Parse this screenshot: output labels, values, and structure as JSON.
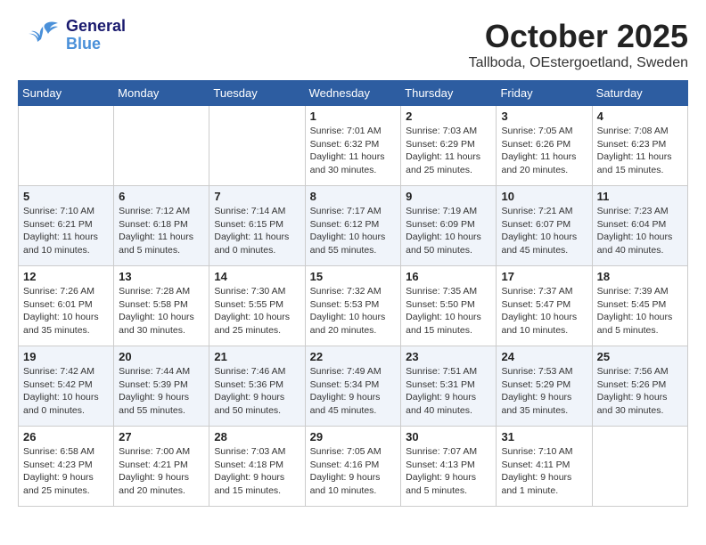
{
  "header": {
    "logo_general": "General",
    "logo_blue": "Blue",
    "month_title": "October 2025",
    "location": "Tallboda, OEstergoetland, Sweden"
  },
  "days_of_week": [
    "Sunday",
    "Monday",
    "Tuesday",
    "Wednesday",
    "Thursday",
    "Friday",
    "Saturday"
  ],
  "weeks": [
    {
      "id": "week1",
      "cells": [
        {
          "day": "",
          "number": "",
          "info": ""
        },
        {
          "day": "monday",
          "number": "",
          "info": ""
        },
        {
          "day": "tuesday",
          "number": "",
          "info": ""
        },
        {
          "day": "wednesday",
          "number": "1",
          "info": "Sunrise: 7:01 AM\nSunset: 6:32 PM\nDaylight: 11 hours\nand 30 minutes."
        },
        {
          "day": "thursday",
          "number": "2",
          "info": "Sunrise: 7:03 AM\nSunset: 6:29 PM\nDaylight: 11 hours\nand 25 minutes."
        },
        {
          "day": "friday",
          "number": "3",
          "info": "Sunrise: 7:05 AM\nSunset: 6:26 PM\nDaylight: 11 hours\nand 20 minutes."
        },
        {
          "day": "saturday",
          "number": "4",
          "info": "Sunrise: 7:08 AM\nSunset: 6:23 PM\nDaylight: 11 hours\nand 15 minutes."
        }
      ]
    },
    {
      "id": "week2",
      "cells": [
        {
          "day": "sunday",
          "number": "5",
          "info": "Sunrise: 7:10 AM\nSunset: 6:21 PM\nDaylight: 11 hours\nand 10 minutes."
        },
        {
          "day": "monday",
          "number": "6",
          "info": "Sunrise: 7:12 AM\nSunset: 6:18 PM\nDaylight: 11 hours\nand 5 minutes."
        },
        {
          "day": "tuesday",
          "number": "7",
          "info": "Sunrise: 7:14 AM\nSunset: 6:15 PM\nDaylight: 11 hours\nand 0 minutes."
        },
        {
          "day": "wednesday",
          "number": "8",
          "info": "Sunrise: 7:17 AM\nSunset: 6:12 PM\nDaylight: 10 hours\nand 55 minutes."
        },
        {
          "day": "thursday",
          "number": "9",
          "info": "Sunrise: 7:19 AM\nSunset: 6:09 PM\nDaylight: 10 hours\nand 50 minutes."
        },
        {
          "day": "friday",
          "number": "10",
          "info": "Sunrise: 7:21 AM\nSunset: 6:07 PM\nDaylight: 10 hours\nand 45 minutes."
        },
        {
          "day": "saturday",
          "number": "11",
          "info": "Sunrise: 7:23 AM\nSunset: 6:04 PM\nDaylight: 10 hours\nand 40 minutes."
        }
      ]
    },
    {
      "id": "week3",
      "cells": [
        {
          "day": "sunday",
          "number": "12",
          "info": "Sunrise: 7:26 AM\nSunset: 6:01 PM\nDaylight: 10 hours\nand 35 minutes."
        },
        {
          "day": "monday",
          "number": "13",
          "info": "Sunrise: 7:28 AM\nSunset: 5:58 PM\nDaylight: 10 hours\nand 30 minutes."
        },
        {
          "day": "tuesday",
          "number": "14",
          "info": "Sunrise: 7:30 AM\nSunset: 5:55 PM\nDaylight: 10 hours\nand 25 minutes."
        },
        {
          "day": "wednesday",
          "number": "15",
          "info": "Sunrise: 7:32 AM\nSunset: 5:53 PM\nDaylight: 10 hours\nand 20 minutes."
        },
        {
          "day": "thursday",
          "number": "16",
          "info": "Sunrise: 7:35 AM\nSunset: 5:50 PM\nDaylight: 10 hours\nand 15 minutes."
        },
        {
          "day": "friday",
          "number": "17",
          "info": "Sunrise: 7:37 AM\nSunset: 5:47 PM\nDaylight: 10 hours\nand 10 minutes."
        },
        {
          "day": "saturday",
          "number": "18",
          "info": "Sunrise: 7:39 AM\nSunset: 5:45 PM\nDaylight: 10 hours\nand 5 minutes."
        }
      ]
    },
    {
      "id": "week4",
      "cells": [
        {
          "day": "sunday",
          "number": "19",
          "info": "Sunrise: 7:42 AM\nSunset: 5:42 PM\nDaylight: 10 hours\nand 0 minutes."
        },
        {
          "day": "monday",
          "number": "20",
          "info": "Sunrise: 7:44 AM\nSunset: 5:39 PM\nDaylight: 9 hours\nand 55 minutes."
        },
        {
          "day": "tuesday",
          "number": "21",
          "info": "Sunrise: 7:46 AM\nSunset: 5:36 PM\nDaylight: 9 hours\nand 50 minutes."
        },
        {
          "day": "wednesday",
          "number": "22",
          "info": "Sunrise: 7:49 AM\nSunset: 5:34 PM\nDaylight: 9 hours\nand 45 minutes."
        },
        {
          "day": "thursday",
          "number": "23",
          "info": "Sunrise: 7:51 AM\nSunset: 5:31 PM\nDaylight: 9 hours\nand 40 minutes."
        },
        {
          "day": "friday",
          "number": "24",
          "info": "Sunrise: 7:53 AM\nSunset: 5:29 PM\nDaylight: 9 hours\nand 35 minutes."
        },
        {
          "day": "saturday",
          "number": "25",
          "info": "Sunrise: 7:56 AM\nSunset: 5:26 PM\nDaylight: 9 hours\nand 30 minutes."
        }
      ]
    },
    {
      "id": "week5",
      "cells": [
        {
          "day": "sunday",
          "number": "26",
          "info": "Sunrise: 6:58 AM\nSunset: 4:23 PM\nDaylight: 9 hours\nand 25 minutes."
        },
        {
          "day": "monday",
          "number": "27",
          "info": "Sunrise: 7:00 AM\nSunset: 4:21 PM\nDaylight: 9 hours\nand 20 minutes."
        },
        {
          "day": "tuesday",
          "number": "28",
          "info": "Sunrise: 7:03 AM\nSunset: 4:18 PM\nDaylight: 9 hours\nand 15 minutes."
        },
        {
          "day": "wednesday",
          "number": "29",
          "info": "Sunrise: 7:05 AM\nSunset: 4:16 PM\nDaylight: 9 hours\nand 10 minutes."
        },
        {
          "day": "thursday",
          "number": "30",
          "info": "Sunrise: 7:07 AM\nSunset: 4:13 PM\nDaylight: 9 hours\nand 5 minutes."
        },
        {
          "day": "friday",
          "number": "31",
          "info": "Sunrise: 7:10 AM\nSunset: 4:11 PM\nDaylight: 9 hours\nand 1 minute."
        },
        {
          "day": "saturday",
          "number": "",
          "info": ""
        }
      ]
    }
  ]
}
